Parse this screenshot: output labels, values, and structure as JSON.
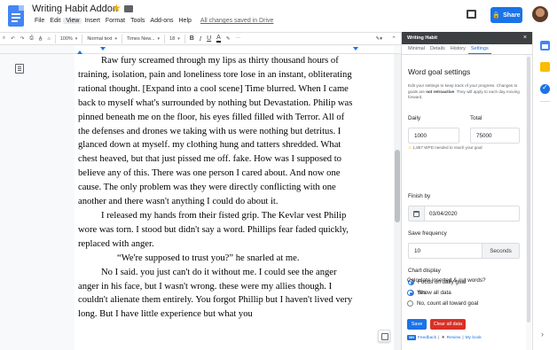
{
  "header": {
    "title": "Writing Habit Addon",
    "menu": [
      "File",
      "Edit",
      "View",
      "Insert",
      "Format",
      "Tools",
      "Add-ons",
      "Help"
    ],
    "active_menu": "View",
    "saved_status": "All changes saved in Drive",
    "share_label": "Share"
  },
  "toolbar": {
    "zoom": "100%",
    "style": "Normal text",
    "font": "Times New...",
    "font_size": "18",
    "bold": "B",
    "italic": "I",
    "underline": "U",
    "text_color": "A"
  },
  "document": {
    "paragraphs": [
      "Raw fury screamed through my lips as thirty thousand hours of training, isolation, pain and loneliness tore lose in an instant, obliterating rational thought. [Expand into a cool scene] Time blurred. When I came back to myself what's surrounded by nothing but Devastation. Philip was pinned beneath me on the floor, his eyes filled filled with Terror. All of the defenses and drones we taking with us were nothing but detritus. I glanced down at myself. my clothing hung and tatters shredded. What chest heaved, but that just pissed me off. fake. How was I supposed to believe any of this. There was one person I cared about. And now one cause. The only problem was they were directly conflicting with one another and there wasn't anything I could do about it.",
      "I released my hands from their fisted grip. The Kevlar vest Philip wore was torn. I stood but didn't say a word. Phillips fear faded quickly, replaced with anger.",
      "“We're supposed to trust you?” he snarled at me.",
      "No I said. you just can't do it without me.  I could see the anger anger in his face, but I wasn't wrong. these were my allies though. I couldn't alienate them entirely. You forgot Phillip but I haven't lived very long. But I have little experience but what you"
    ]
  },
  "sidebar": {
    "header": "Writing Habit",
    "close": "×",
    "tabs": [
      "Minimal",
      "Details",
      "History",
      "Settings"
    ],
    "active_tab": "Settings",
    "title": "Word goal settings",
    "description_1": "Edit your settings to keep track of your progress. Changes to goals are ",
    "description_bold": "not retroactive",
    "description_2": ". They will apply to each day moving forward.",
    "daily_label": "Daily",
    "daily_value": "1000",
    "total_label": "Total",
    "total_value": "75000",
    "warning_icon": "⚠",
    "warning": "1,857 WPD needed to reach your goal",
    "finish_label": "Finish by",
    "finish_value": "03/04/2020",
    "save_freq_label": "Save frequency",
    "save_freq_value": "10",
    "save_freq_unit": "Seconds",
    "chart_label": "Chart display",
    "chart_opt1": "Focus on daily goal",
    "chart_opt2": "Show all data",
    "calc_label": "Calculate inserted & cut words?",
    "calc_opt1": "Yes",
    "calc_opt2": "No, count all toward goal",
    "save_btn": "Save",
    "clear_btn": "Clear all data",
    "footer_logo": "WH",
    "footer_feedback": "Feedback",
    "footer_review": "Review",
    "footer_book": "My book"
  }
}
